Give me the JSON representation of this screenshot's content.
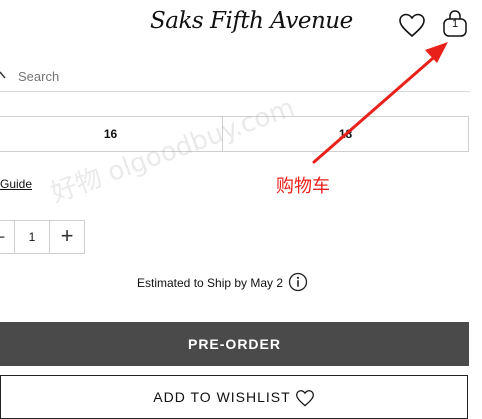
{
  "header": {
    "logo_text": "Saks Fifth Avenue",
    "cart_count": "1"
  },
  "search": {
    "placeholder": "Search"
  },
  "sizes": [
    "16",
    "18"
  ],
  "size_guide_label": "Guide",
  "quantity": {
    "minus": "−",
    "value": "1",
    "plus": "+"
  },
  "ship_text": "Estimated to Ship by May 2",
  "buttons": {
    "preorder": "PRE-ORDER",
    "wishlist": "ADD TO WISHLIST"
  },
  "annotation": {
    "label": "购物车",
    "color": "#e8211b"
  },
  "watermark": "好物 olgoodbuy.com"
}
